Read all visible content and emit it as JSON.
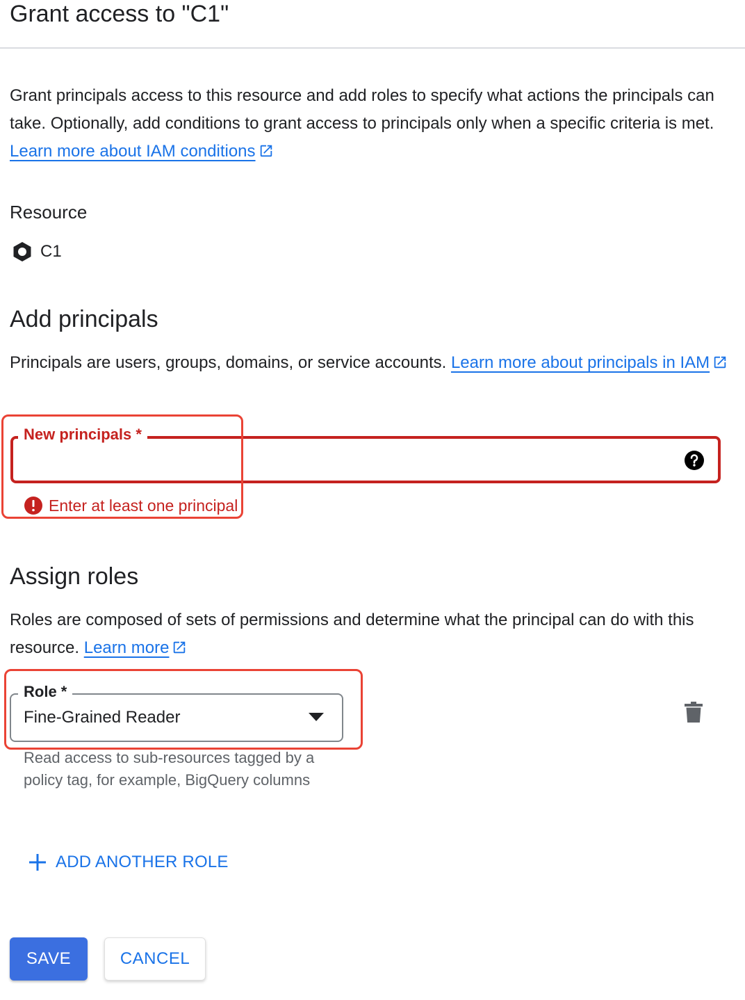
{
  "dialog": {
    "title": "Grant access to \"C1\""
  },
  "intro": {
    "text": "Grant principals access to this resource and add roles to specify what actions the principals can take. Optionally, add conditions to grant access to principals only when a specific criteria is met. ",
    "link": "Learn more about IAM conditions"
  },
  "resource": {
    "heading": "Resource",
    "name": "C1",
    "icon": "resource-hexagon-icon"
  },
  "principals": {
    "heading": "Add principals",
    "desc": "Principals are users, groups, domains, or service accounts. ",
    "link": "Learn more about principals in IAM",
    "field_label": "New principals *",
    "field_value": "",
    "help_icon": "help-icon",
    "error": "Enter at least one principal"
  },
  "roles": {
    "heading": "Assign roles",
    "desc": "Roles are composed of sets of permissions and determine what the principal can do with this resource. ",
    "link": "Learn more",
    "field_label": "Role *",
    "selected": "Fine-Grained Reader",
    "hint": "Read access to sub-resources tagged by a policy tag, for example, BigQuery columns",
    "delete_icon": "trash-icon",
    "add_label": "ADD ANOTHER ROLE"
  },
  "actions": {
    "save": "SAVE",
    "cancel": "CANCEL"
  },
  "colors": {
    "accent": "#1a73e8",
    "error": "#c5221f",
    "save_bg": "#3b6fe0",
    "highlight": "#ea4335"
  }
}
